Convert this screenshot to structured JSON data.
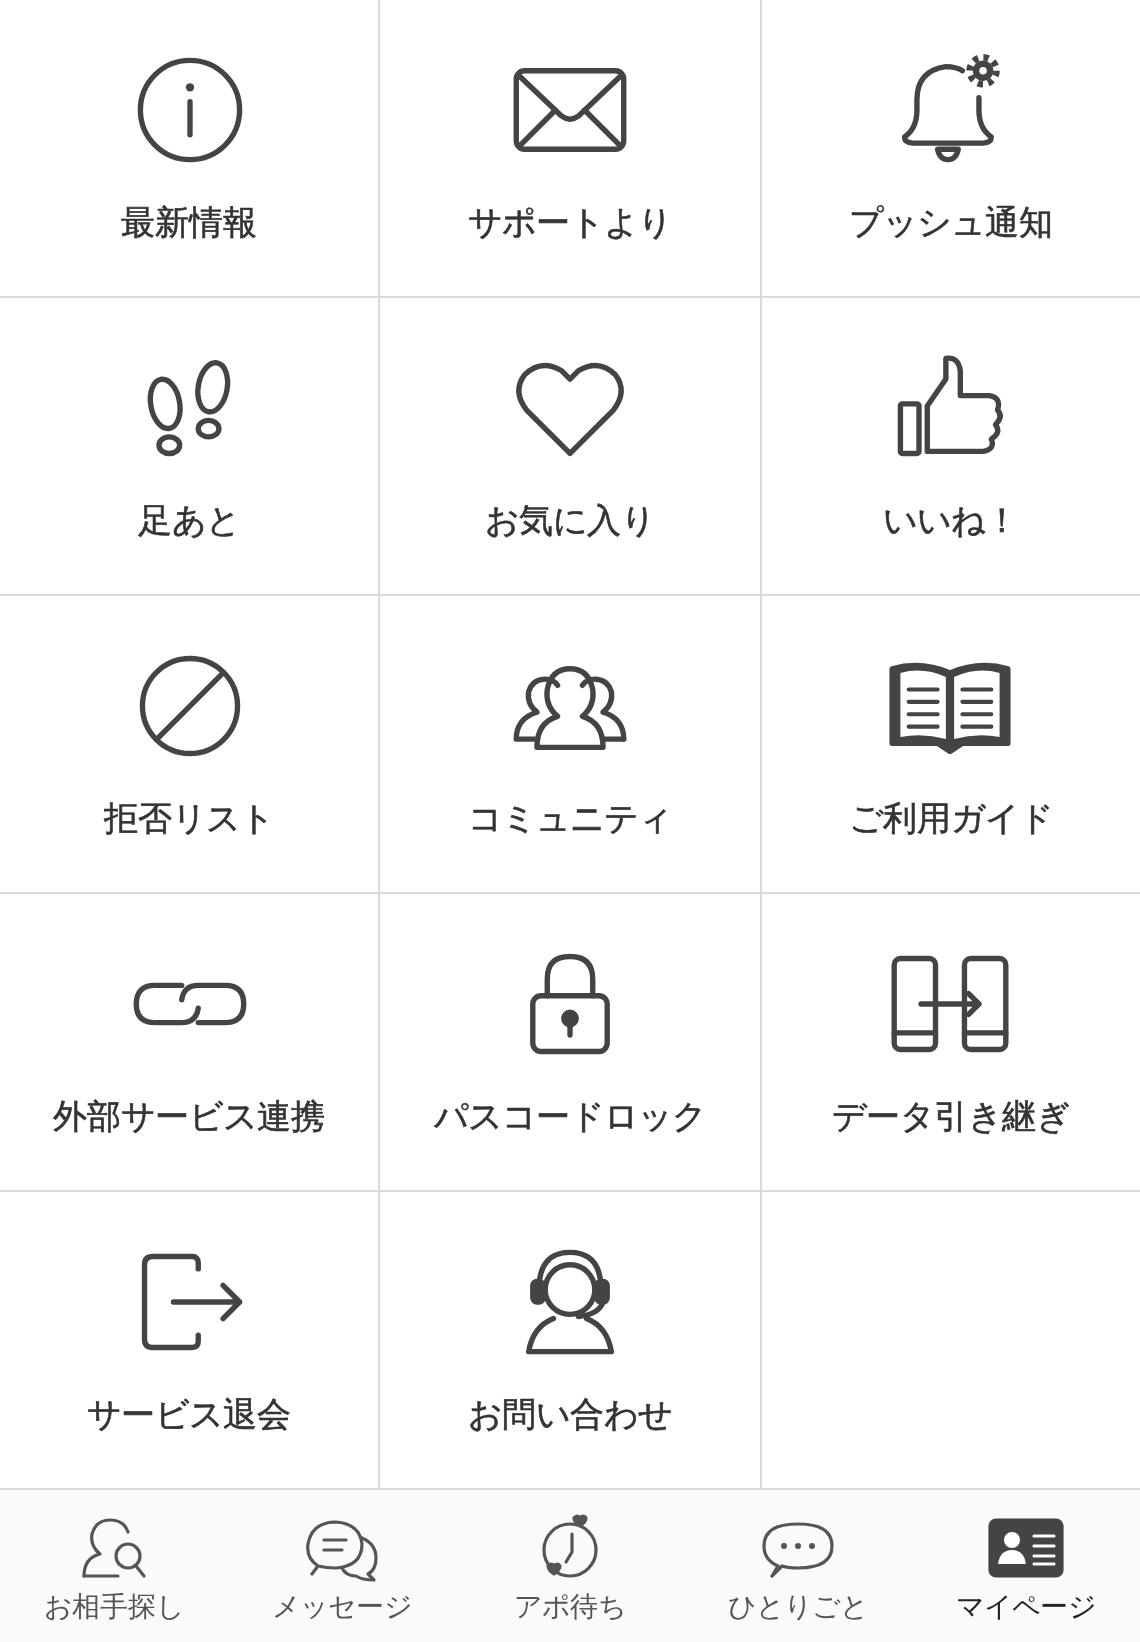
{
  "menu": [
    {
      "kind": "info",
      "label": "最新情報"
    },
    {
      "kind": "mail",
      "label": "サポートより"
    },
    {
      "kind": "bell",
      "label": "プッシュ通知"
    },
    {
      "kind": "footprints",
      "label": "足あと"
    },
    {
      "kind": "heart",
      "label": "お気に入り"
    },
    {
      "kind": "thumbs",
      "label": "いいね！"
    },
    {
      "kind": "block",
      "label": "拒否リスト"
    },
    {
      "kind": "people",
      "label": "コミュニティ"
    },
    {
      "kind": "book",
      "label": "ご利用ガイド"
    },
    {
      "kind": "link",
      "label": "外部サービス連携"
    },
    {
      "kind": "lock",
      "label": "パスコードロック"
    },
    {
      "kind": "transfer",
      "label": "データ引き継ぎ"
    },
    {
      "kind": "exit",
      "label": "サービス退会"
    },
    {
      "kind": "headset",
      "label": "お問い合わせ"
    }
  ],
  "tab_bar": [
    {
      "kind": "search",
      "label": "お相手探し",
      "selected": false
    },
    {
      "kind": "message",
      "label": "メッセージ",
      "selected": false
    },
    {
      "kind": "clock",
      "label": "アポ待ち",
      "selected": false
    },
    {
      "kind": "chat",
      "label": "ひとりごと",
      "selected": false
    },
    {
      "kind": "card",
      "label": "マイページ",
      "selected": true
    }
  ]
}
